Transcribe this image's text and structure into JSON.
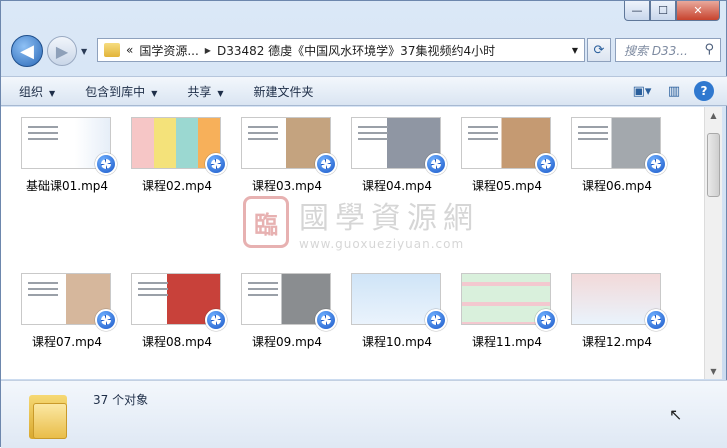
{
  "window": {
    "caption": {
      "minimize": "—",
      "maximize": "☐",
      "close": "✕"
    }
  },
  "nav": {
    "back": "◀",
    "forward": "▶",
    "address": {
      "chevron": "«",
      "crumbs": [
        "国学资源...",
        "D33482 德虔《中国风水环境学》37集视频约4小时"
      ]
    },
    "search_placeholder": "搜索 D33..."
  },
  "toolbar": {
    "organize": "组织",
    "include_library": "包含到库中",
    "share": "共享",
    "new_folder": "新建文件夹"
  },
  "files": [
    {
      "name": "基础课01.mp4",
      "thumb": "a"
    },
    {
      "name": "课程02.mp4",
      "thumb": "b"
    },
    {
      "name": "课程03.mp4",
      "thumb": "c"
    },
    {
      "name": "课程04.mp4",
      "thumb": "d"
    },
    {
      "name": "课程05.mp4",
      "thumb": "e"
    },
    {
      "name": "课程06.mp4",
      "thumb": "f"
    },
    {
      "name": "课程07.mp4",
      "thumb": "g"
    },
    {
      "name": "课程08.mp4",
      "thumb": "h"
    },
    {
      "name": "课程09.mp4",
      "thumb": "i"
    },
    {
      "name": "课程10.mp4",
      "thumb": "j"
    },
    {
      "name": "课程11.mp4",
      "thumb": "k"
    },
    {
      "name": "课程12.mp4",
      "thumb": "l"
    }
  ],
  "watermark": {
    "seal": "臨",
    "title": "國學資源網",
    "url": "www.guoxueziyuan.com"
  },
  "details": {
    "count": "37 个对象"
  },
  "colors": {
    "accent": "#2f78cf",
    "toolbar_bg": "#dae5f2"
  }
}
